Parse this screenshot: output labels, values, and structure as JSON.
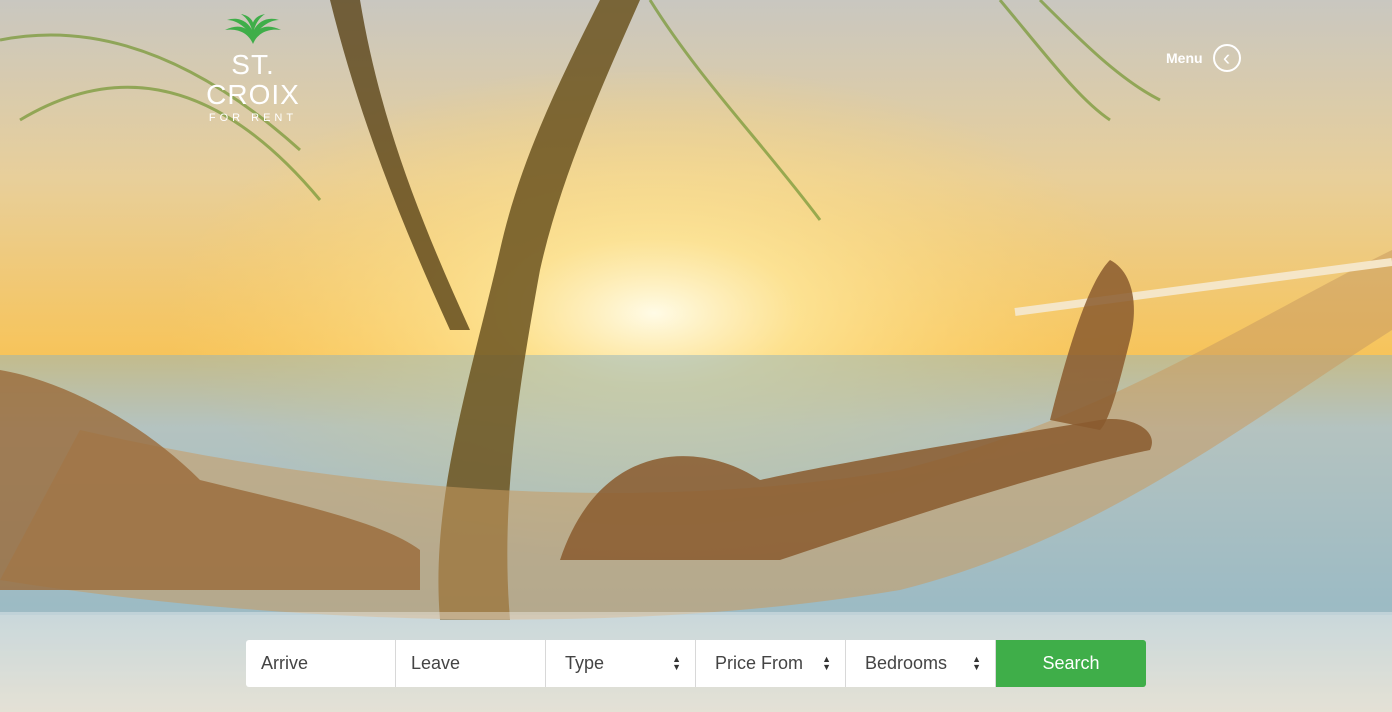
{
  "brand": {
    "title": "ST. CROIX",
    "subtitle": "FOR RENT",
    "palm_color": "#3fae49"
  },
  "header": {
    "menu_label": "Menu",
    "menu_icon": "chevron-left-icon"
  },
  "search": {
    "arrive_placeholder": "Arrive",
    "leave_placeholder": "Leave",
    "type_label": "Type",
    "price_label": "Price From",
    "bedrooms_label": "Bedrooms",
    "submit_label": "Search",
    "submit_color": "#3fae49"
  }
}
